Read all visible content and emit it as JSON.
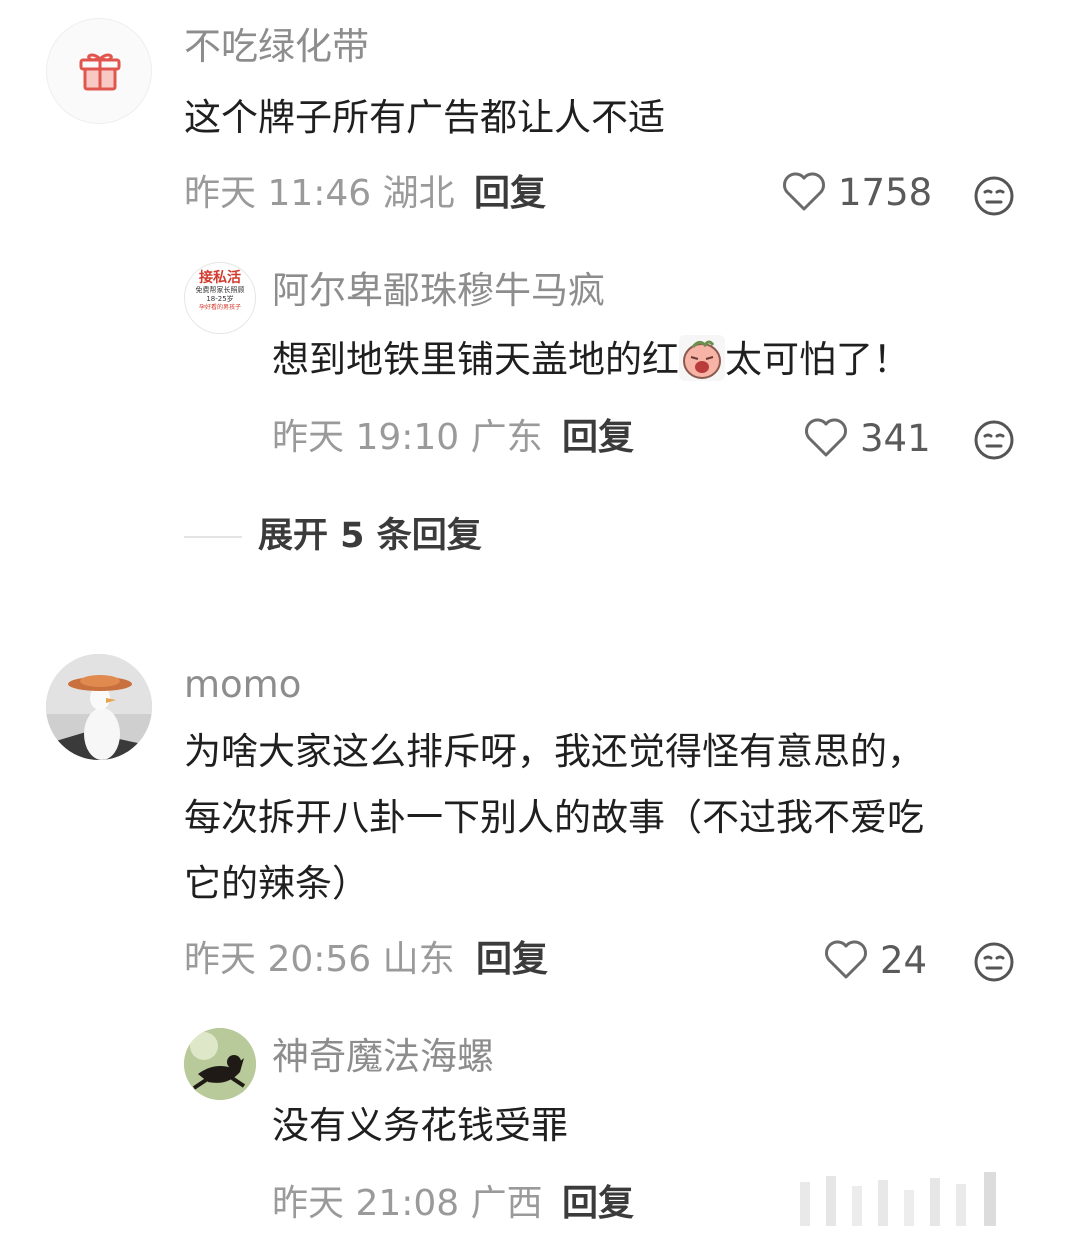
{
  "comments": [
    {
      "username": "不吃绿化带",
      "text": "这个牌子所有广告都让人不适",
      "time": "昨天 11:46 湖北",
      "reply_label": "回复",
      "likes": "1758",
      "replies": [
        {
          "username": "阿尔卑鄙珠穆牛马疯",
          "avatar_text": [
            "接私活",
            "免费帮家长照顾",
            "18-25岁",
            "孕好看的男孩子"
          ],
          "text_before": "想到地铁里铺天盖地的红",
          "text_after": "太可怕了！",
          "time": "昨天 19:10 广东",
          "reply_label": "回复",
          "likes": "341"
        }
      ],
      "expand_label": "展开 5 条回复"
    },
    {
      "username": "momo",
      "text_lines": [
        "为啥大家这么排斥呀，我还觉得怪有意思的，",
        "每次拆开八卦一下别人的故事（不过我不爱吃",
        "它的辣条）"
      ],
      "time": "昨天 20:56 山东",
      "reply_label": "回复",
      "likes": "24",
      "replies": [
        {
          "username": "神奇魔法海螺",
          "text": "没有义务花钱受罪",
          "time": "昨天 21:08 广西",
          "reply_label": "回复"
        }
      ]
    }
  ],
  "colors": {
    "username": "#8d8d8d",
    "text": "#1f1f1f",
    "meta": "#9a9a9a",
    "gift": "#e0564f"
  }
}
